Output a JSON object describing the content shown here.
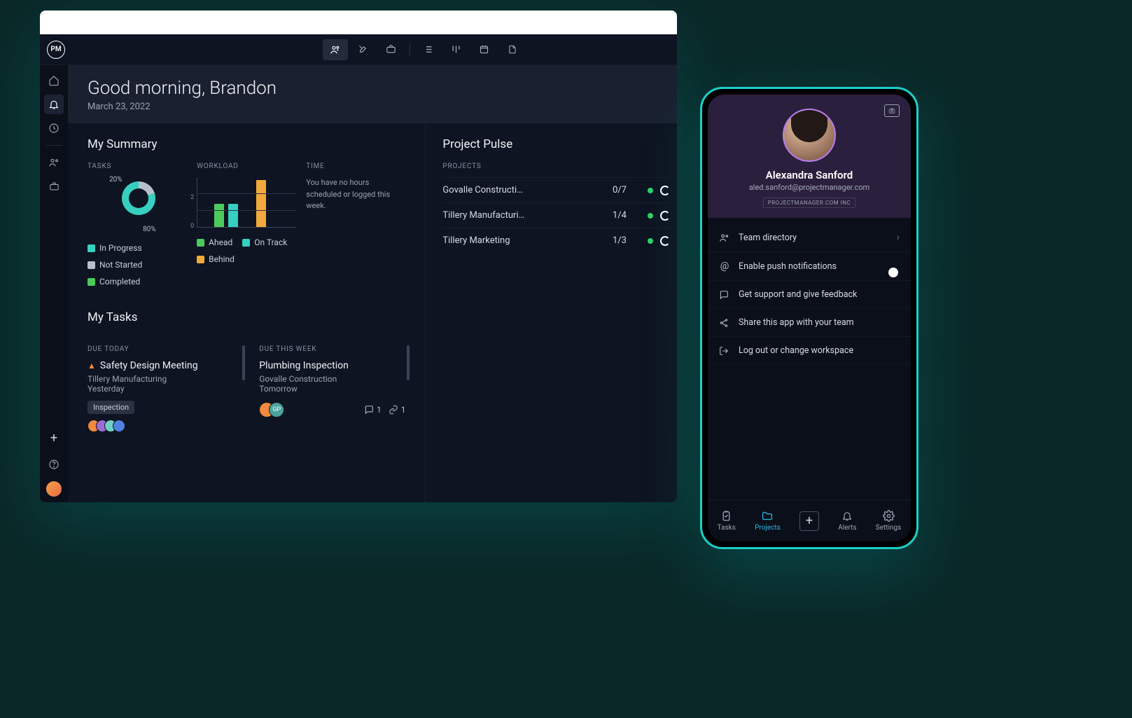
{
  "logo_text": "PM",
  "header": {
    "greeting": "Good morning, Brandon",
    "date": "March 23, 2022"
  },
  "summary": {
    "title": "My Summary",
    "tasks_label": "TASKS",
    "workload_label": "WORKLOAD",
    "time_label": "TIME",
    "donut_top": "20%",
    "donut_bottom": "80%",
    "time_message": "You have no hours scheduled or logged this week.",
    "legend_tasks": {
      "in_progress": "In Progress",
      "not_started": "Not Started",
      "completed": "Completed"
    },
    "legend_workload": {
      "ahead": "Ahead",
      "on_track": "On Track",
      "behind": "Behind"
    },
    "bar_ticks": {
      "t0": "0",
      "t2": "2"
    }
  },
  "chart_data": [
    {
      "type": "pie",
      "title": "Tasks",
      "series": [
        {
          "name": "Not Started",
          "value": 20,
          "color": "#b7bfcb"
        },
        {
          "name": "In Progress",
          "value": 80,
          "color": "#36cfc0"
        }
      ]
    },
    {
      "type": "bar",
      "title": "Workload",
      "ylabel": "",
      "ylim": [
        0,
        3
      ],
      "categories": [
        "",
        "",
        "",
        "",
        ""
      ],
      "series": [
        {
          "name": "Ahead",
          "values": [
            0,
            1.5,
            0,
            0,
            0
          ],
          "color": "#4bcb5b"
        },
        {
          "name": "On Track",
          "values": [
            0,
            0,
            1.5,
            0,
            0
          ],
          "color": "#36cfc0"
        },
        {
          "name": "Behind",
          "values": [
            0,
            0,
            0,
            0,
            3
          ],
          "color": "#f2a93b"
        }
      ]
    }
  ],
  "tasks": {
    "title": "My Tasks",
    "due_today_label": "DUE TODAY",
    "due_week_label": "DUE THIS WEEK",
    "today": {
      "name": "Safety Design Meeting",
      "project": "Tillery Manufacturing",
      "when": "Yesterday",
      "tag": "Inspection"
    },
    "week": {
      "name": "Plumbing Inspection",
      "project": "Govalle Construction",
      "when": "Tomorrow",
      "avatar_initials": "GP",
      "comments": "1",
      "links": "1"
    }
  },
  "pulse": {
    "title": "Project Pulse",
    "label": "PROJECTS",
    "rows": [
      {
        "name": "Govalle Constructi…",
        "progress": "0/7"
      },
      {
        "name": "Tillery Manufacturi…",
        "progress": "1/4"
      },
      {
        "name": "Tillery Marketing",
        "progress": "1/3"
      }
    ]
  },
  "mobile": {
    "name": "Alexandra Sanford",
    "email": "aled.sanford@projectmanager.com",
    "org": "PROJECTMANAGER.COM INC",
    "menu": {
      "directory": "Team directory",
      "push": "Enable push notifications",
      "support": "Get support and give feedback",
      "share": "Share this app with your team",
      "logout": "Log out or change workspace"
    },
    "tabs": {
      "tasks": "Tasks",
      "projects": "Projects",
      "alerts": "Alerts",
      "settings": "Settings"
    }
  },
  "colors": {
    "teal": "#36cfc0",
    "grey": "#b7bfcb",
    "green": "#4bcb5b",
    "amber": "#f2a93b"
  }
}
